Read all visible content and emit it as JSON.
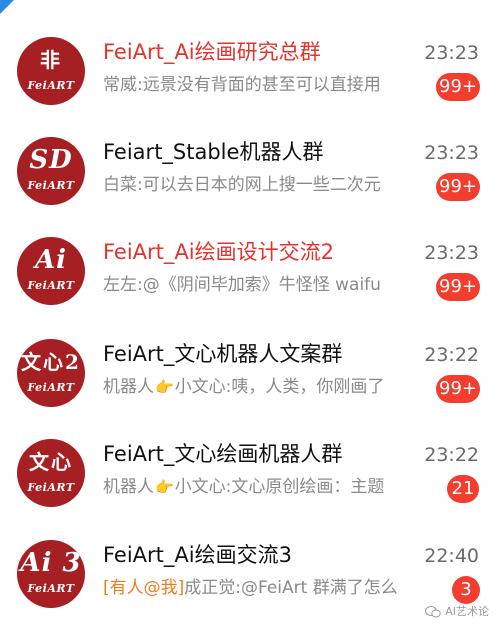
{
  "chats": [
    {
      "avatar_mark": "非",
      "avatar_brand": "FeiART",
      "title": "FeiArt_Ai绘画研究总群",
      "time": "23:23",
      "preview_prefix": "",
      "preview_sender": "常威:",
      "preview_text": "远景没有背面的甚至可以直接用",
      "badge": "99+"
    },
    {
      "avatar_mark": "SD",
      "avatar_brand": "FeiART",
      "title": "Feiart_Stable机器人群",
      "time": "23:23",
      "preview_prefix": "",
      "preview_sender": "白菜:",
      "preview_text": "可以去日本的网上搜一些二次元",
      "badge": "99+"
    },
    {
      "avatar_mark": "Ai",
      "avatar_brand": "FeiART",
      "title": "FeiArt_Ai绘画设计交流2",
      "time": "23:23",
      "preview_prefix": "",
      "preview_sender": "左左:",
      "preview_text": "@《阴间毕加索》牛怪怪 waifu",
      "badge": "99+"
    },
    {
      "avatar_mark": "文心2",
      "avatar_brand": "FeiART",
      "title": "FeiArt_文心机器人文案群",
      "time": "23:22",
      "preview_prefix": "",
      "preview_sender": "机器人",
      "preview_text": "小文心:咦，人类，你刚画了",
      "badge": "99+"
    },
    {
      "avatar_mark": "文心",
      "avatar_brand": "FeiART",
      "title": "FeiArt_文心绘画机器人群",
      "time": "23:22",
      "preview_prefix": "",
      "preview_sender": "机器人",
      "preview_text": "小文心:文心原创绘画：主题",
      "badge": "21"
    },
    {
      "avatar_mark": "Ai 3",
      "avatar_brand": "FeiART",
      "title": "FeiArt_Ai绘画交流3",
      "time": "22:40",
      "preview_prefix": "[有人@我]",
      "preview_sender": "成正觉:",
      "preview_text": "@FeiArt 群满了怎么",
      "badge": "3"
    }
  ],
  "watermark": "AI艺术论",
  "colors": {
    "accent_red": "#e5322d",
    "badge_red": "#f23d2f",
    "avatar_red": "#a61f22",
    "mention_orange": "#f07d1d",
    "corner_blue": "#2a8be6"
  },
  "icons": {
    "pointing_hand": "👉",
    "wechat_logo": "wechat-icon"
  }
}
